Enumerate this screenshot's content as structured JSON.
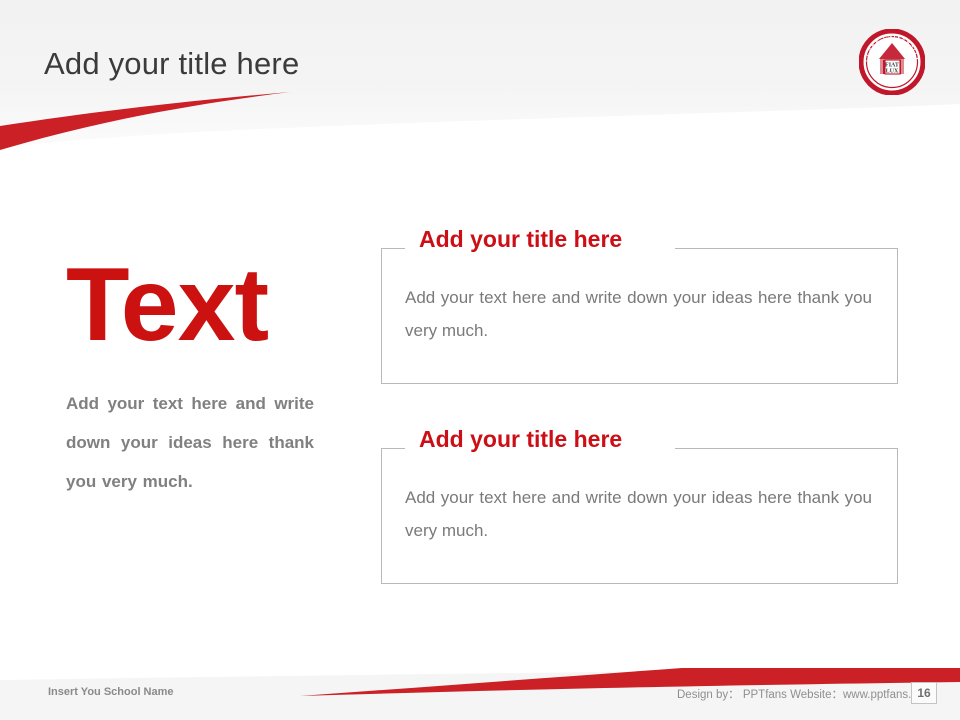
{
  "slide": {
    "title": "Add your title here"
  },
  "logo": {
    "name": "clark-university-seal",
    "outer_text_top": "CLARK UNIVERSITY",
    "outer_text_bottom": "MDCCCLXXXVII",
    "motto_line1": "FIAT",
    "motto_line2": "LUX",
    "color": "#C0172A"
  },
  "left": {
    "headline": "Text",
    "body": "Add your text here and write down your ideas here thank you very much."
  },
  "boxes": [
    {
      "title": "Add your title here",
      "body": "Add your text here and write down your ideas here thank you very much."
    },
    {
      "title": "Add your title here",
      "body": "Add your text here and write down your ideas here thank you very much."
    }
  ],
  "footer": {
    "school_name": "Insert You School Name",
    "credit": "Design by： PPTfans  Website：www.pptfans.cn",
    "page_number": "16"
  },
  "colors": {
    "accent_red": "#CC1111",
    "title_red": "#CC0F16",
    "body_gray": "#7A7A7A",
    "heading_gray": "#3B3B3B"
  }
}
